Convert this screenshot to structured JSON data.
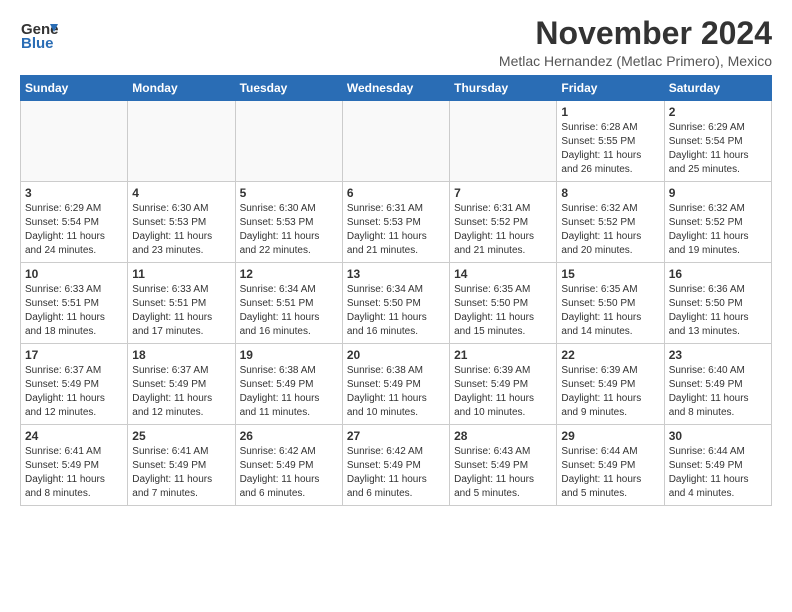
{
  "logo": {
    "general": "General",
    "blue": "Blue"
  },
  "header": {
    "month_title": "November 2024",
    "subtitle": "Metlac Hernandez (Metlac Primero), Mexico"
  },
  "days_of_week": [
    "Sunday",
    "Monday",
    "Tuesday",
    "Wednesday",
    "Thursday",
    "Friday",
    "Saturday"
  ],
  "weeks": [
    [
      {
        "day": "",
        "info": ""
      },
      {
        "day": "",
        "info": ""
      },
      {
        "day": "",
        "info": ""
      },
      {
        "day": "",
        "info": ""
      },
      {
        "day": "",
        "info": ""
      },
      {
        "day": "1",
        "info": "Sunrise: 6:28 AM\nSunset: 5:55 PM\nDaylight: 11 hours and 26 minutes."
      },
      {
        "day": "2",
        "info": "Sunrise: 6:29 AM\nSunset: 5:54 PM\nDaylight: 11 hours and 25 minutes."
      }
    ],
    [
      {
        "day": "3",
        "info": "Sunrise: 6:29 AM\nSunset: 5:54 PM\nDaylight: 11 hours and 24 minutes."
      },
      {
        "day": "4",
        "info": "Sunrise: 6:30 AM\nSunset: 5:53 PM\nDaylight: 11 hours and 23 minutes."
      },
      {
        "day": "5",
        "info": "Sunrise: 6:30 AM\nSunset: 5:53 PM\nDaylight: 11 hours and 22 minutes."
      },
      {
        "day": "6",
        "info": "Sunrise: 6:31 AM\nSunset: 5:53 PM\nDaylight: 11 hours and 21 minutes."
      },
      {
        "day": "7",
        "info": "Sunrise: 6:31 AM\nSunset: 5:52 PM\nDaylight: 11 hours and 21 minutes."
      },
      {
        "day": "8",
        "info": "Sunrise: 6:32 AM\nSunset: 5:52 PM\nDaylight: 11 hours and 20 minutes."
      },
      {
        "day": "9",
        "info": "Sunrise: 6:32 AM\nSunset: 5:52 PM\nDaylight: 11 hours and 19 minutes."
      }
    ],
    [
      {
        "day": "10",
        "info": "Sunrise: 6:33 AM\nSunset: 5:51 PM\nDaylight: 11 hours and 18 minutes."
      },
      {
        "day": "11",
        "info": "Sunrise: 6:33 AM\nSunset: 5:51 PM\nDaylight: 11 hours and 17 minutes."
      },
      {
        "day": "12",
        "info": "Sunrise: 6:34 AM\nSunset: 5:51 PM\nDaylight: 11 hours and 16 minutes."
      },
      {
        "day": "13",
        "info": "Sunrise: 6:34 AM\nSunset: 5:50 PM\nDaylight: 11 hours and 16 minutes."
      },
      {
        "day": "14",
        "info": "Sunrise: 6:35 AM\nSunset: 5:50 PM\nDaylight: 11 hours and 15 minutes."
      },
      {
        "day": "15",
        "info": "Sunrise: 6:35 AM\nSunset: 5:50 PM\nDaylight: 11 hours and 14 minutes."
      },
      {
        "day": "16",
        "info": "Sunrise: 6:36 AM\nSunset: 5:50 PM\nDaylight: 11 hours and 13 minutes."
      }
    ],
    [
      {
        "day": "17",
        "info": "Sunrise: 6:37 AM\nSunset: 5:49 PM\nDaylight: 11 hours and 12 minutes."
      },
      {
        "day": "18",
        "info": "Sunrise: 6:37 AM\nSunset: 5:49 PM\nDaylight: 11 hours and 12 minutes."
      },
      {
        "day": "19",
        "info": "Sunrise: 6:38 AM\nSunset: 5:49 PM\nDaylight: 11 hours and 11 minutes."
      },
      {
        "day": "20",
        "info": "Sunrise: 6:38 AM\nSunset: 5:49 PM\nDaylight: 11 hours and 10 minutes."
      },
      {
        "day": "21",
        "info": "Sunrise: 6:39 AM\nSunset: 5:49 PM\nDaylight: 11 hours and 10 minutes."
      },
      {
        "day": "22",
        "info": "Sunrise: 6:39 AM\nSunset: 5:49 PM\nDaylight: 11 hours and 9 minutes."
      },
      {
        "day": "23",
        "info": "Sunrise: 6:40 AM\nSunset: 5:49 PM\nDaylight: 11 hours and 8 minutes."
      }
    ],
    [
      {
        "day": "24",
        "info": "Sunrise: 6:41 AM\nSunset: 5:49 PM\nDaylight: 11 hours and 8 minutes."
      },
      {
        "day": "25",
        "info": "Sunrise: 6:41 AM\nSunset: 5:49 PM\nDaylight: 11 hours and 7 minutes."
      },
      {
        "day": "26",
        "info": "Sunrise: 6:42 AM\nSunset: 5:49 PM\nDaylight: 11 hours and 6 minutes."
      },
      {
        "day": "27",
        "info": "Sunrise: 6:42 AM\nSunset: 5:49 PM\nDaylight: 11 hours and 6 minutes."
      },
      {
        "day": "28",
        "info": "Sunrise: 6:43 AM\nSunset: 5:49 PM\nDaylight: 11 hours and 5 minutes."
      },
      {
        "day": "29",
        "info": "Sunrise: 6:44 AM\nSunset: 5:49 PM\nDaylight: 11 hours and 5 minutes."
      },
      {
        "day": "30",
        "info": "Sunrise: 6:44 AM\nSunset: 5:49 PM\nDaylight: 11 hours and 4 minutes."
      }
    ]
  ]
}
